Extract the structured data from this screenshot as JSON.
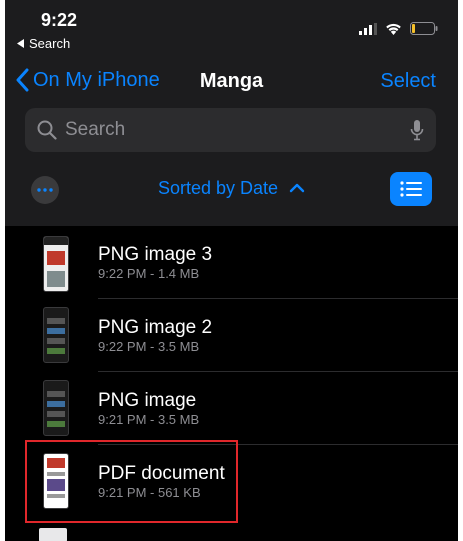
{
  "status_bar": {
    "time": "9:22",
    "back_label": "Search"
  },
  "nav": {
    "back_label": "On My iPhone",
    "title": "Manga",
    "select_label": "Select"
  },
  "search": {
    "placeholder": "Search"
  },
  "toolbar": {
    "sort_label": "Sorted by Date"
  },
  "files": [
    {
      "name": "PNG image 3",
      "meta": "9:22 PM - 1.4 MB"
    },
    {
      "name": "PNG image 2",
      "meta": "9:22 PM - 3.5 MB"
    },
    {
      "name": "PNG image",
      "meta": "9:21 PM - 3.5 MB"
    },
    {
      "name": "PDF document",
      "meta": "9:21 PM - 561 KB"
    }
  ],
  "colors": {
    "accent": "#0a84ff",
    "highlight": "#e0272b",
    "background": "#000000"
  }
}
